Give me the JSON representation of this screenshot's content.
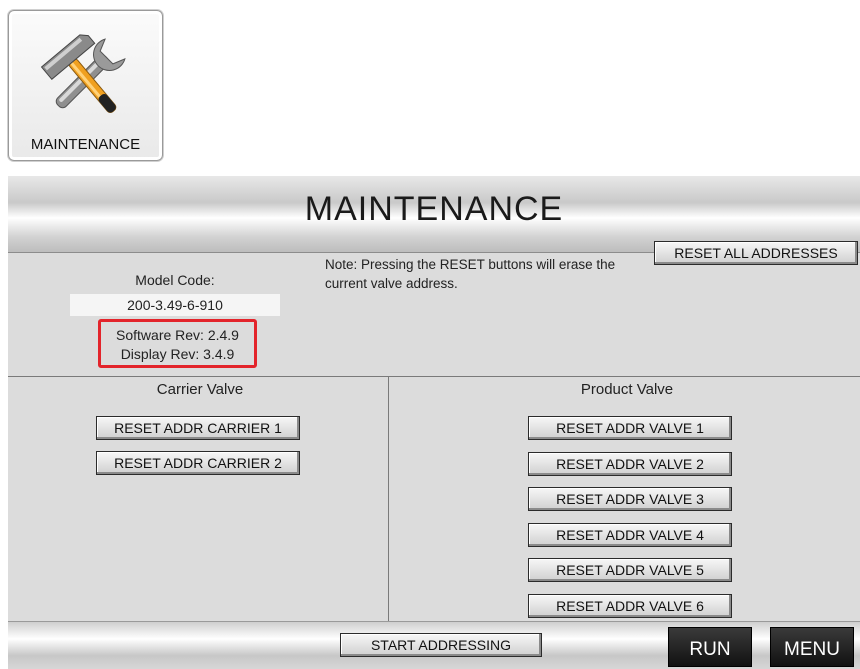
{
  "icon": {
    "label": "MAINTENANCE",
    "name": "hammer-wrench-icon"
  },
  "panel": {
    "title": "MAINTENANCE",
    "model_label": "Model Code:",
    "model_code": "200-3.49-6-910",
    "software_rev": "Software Rev:  2.4.9",
    "display_rev": "Display Rev: 3.4.9",
    "note": "Note: Pressing the RESET buttons will erase the current valve address.",
    "reset_all_label": "RESET ALL ADDRESSES"
  },
  "carrier": {
    "heading": "Carrier Valve",
    "buttons": [
      "RESET ADDR CARRIER 1",
      "RESET ADDR CARRIER 2"
    ]
  },
  "product": {
    "heading": "Product Valve",
    "buttons": [
      "RESET ADDR VALVE 1",
      "RESET ADDR VALVE 2",
      "RESET ADDR VALVE 3",
      "RESET ADDR VALVE 4",
      "RESET ADDR VALVE 5",
      "RESET ADDR VALVE 6"
    ]
  },
  "footer": {
    "start_label": "START ADDRESSING",
    "run_label": "RUN",
    "menu_label": "MENU"
  },
  "colors": {
    "highlight_border": "#e3242b",
    "panel_bg": "#dcdcdc",
    "dark_button": "#111111"
  }
}
